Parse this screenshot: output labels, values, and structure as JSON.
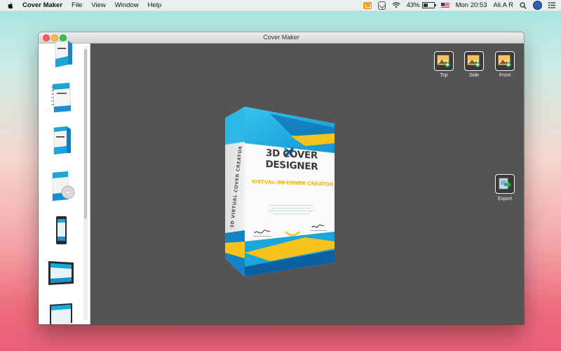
{
  "menubar": {
    "app_name": "Cover Maker",
    "menus": [
      "File",
      "View",
      "Window",
      "Help"
    ],
    "battery_percent": "43%",
    "clock": "Mon 20:53",
    "user": "Ali.A R"
  },
  "window": {
    "title": "Cover Maker"
  },
  "toolbar": {
    "top_label": "Top",
    "side_label": "Side",
    "front_label": "Front",
    "export_label": "Export"
  },
  "cover": {
    "title": "3D COVER DESIGNER",
    "tagline": "VIRTUAL 3D COVER CREATOR",
    "spine_text": "3D VIRTUAL COVER CREATOR",
    "colors": {
      "accent_blue": "#1aa6d8",
      "accent_yellow": "#f7c21c",
      "dark_blue": "#0c5fa0"
    }
  },
  "colors": {
    "canvas": "#545454",
    "sidebar": "#ffffff"
  },
  "sidebar": {
    "templates": [
      "box-template",
      "spiral-book-template",
      "box-template-2",
      "dvd-case-template",
      "phone-template",
      "tablet-landscape-template",
      "monitor-template"
    ]
  }
}
